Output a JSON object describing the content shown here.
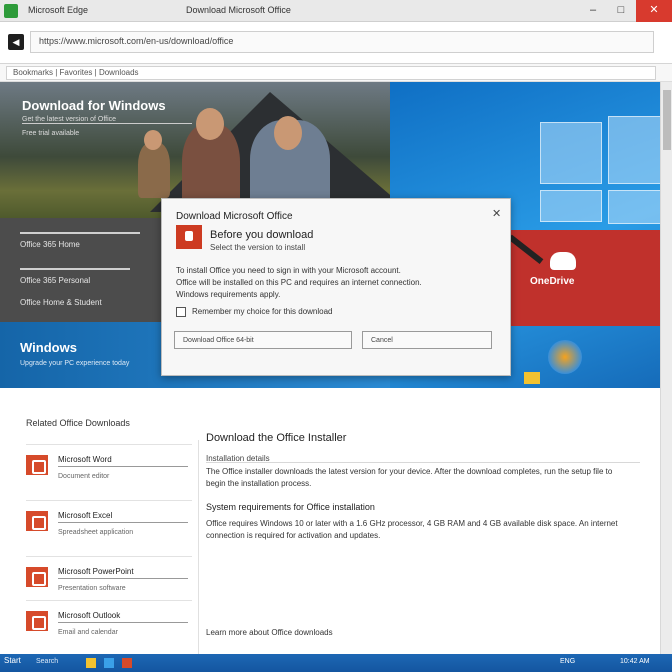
{
  "window": {
    "app_title": "Microsoft Edge",
    "tab_title": "Download Microsoft Office",
    "minimize_glyph": "–",
    "maximize_glyph": "□",
    "close_glyph": "✕"
  },
  "address_bar": {
    "url": "https://www.microsoft.com/en-us/download/office",
    "bookmarks": "Bookmarks  |  Favorites  |  Downloads"
  },
  "hero": {
    "heading": "Download for Windows",
    "subtext": "Get the latest version of Office",
    "subtext2": "Free trial available",
    "mid_lines": [
      "Office 365 Home",
      "Office 365 Personal",
      "Office Home & Student"
    ],
    "banner_title": "Windows",
    "banner_sub": "Upgrade your PC experience today",
    "promo_text": "OneDrive"
  },
  "dialog": {
    "title": "Download Microsoft Office",
    "heading": "Before you download",
    "subheading": "Select the version to install",
    "body_lines": [
      "To install Office you need to sign in with your Microsoft account.",
      "Office will be installed on this PC and requires an internet connection.",
      "Windows requirements apply."
    ],
    "checkbox_label": "Remember my choice for this download",
    "primary_button": "Download Office 64-bit",
    "secondary_button": "Cancel"
  },
  "sidebar": {
    "heading": "Related Office Downloads",
    "items": [
      {
        "label": "Microsoft Word",
        "desc": "Document editor"
      },
      {
        "label": "Microsoft Excel",
        "desc": "Spreadsheet application"
      },
      {
        "label": "Microsoft PowerPoint",
        "desc": "Presentation software"
      },
      {
        "label": "Microsoft Outlook",
        "desc": "Email and calendar"
      }
    ]
  },
  "content": {
    "title": "Download the Office Installer",
    "label": "Installation details",
    "para1": "The Office installer downloads the latest version for your device. After the download completes, run the setup file to begin the installation process.",
    "subtitle": "System requirements for Office installation",
    "para2": "Office requires Windows 10 or later with a 1.6 GHz processor, 4 GB RAM and 4 GB available disk space. An internet connection is required for activation and updates.",
    "footer": "Learn more about Office downloads"
  },
  "taskbar": {
    "start_label": "Start",
    "search_label": "Search",
    "tray": "ENG",
    "time": "10:42 AM"
  },
  "colors": {
    "accent_blue": "#1f7fd1",
    "office_red": "#d64a2a",
    "close_red": "#d83a2e"
  }
}
